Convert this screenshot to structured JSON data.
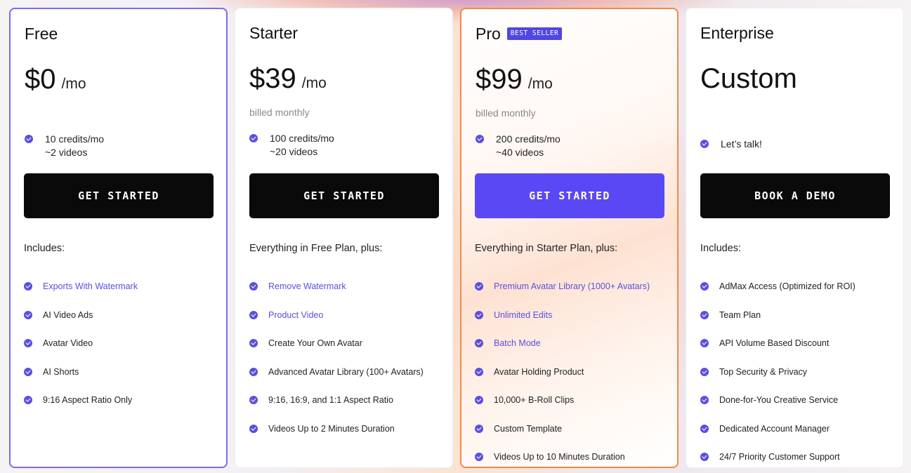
{
  "colors": {
    "accent": "#5a48f5",
    "highlight_text": "#5b4fe0",
    "pro_border": "#f08a4b",
    "free_border": "#7b6cf2"
  },
  "plans": [
    {
      "name": "Free",
      "price": "$0",
      "per": "/mo",
      "billed": "",
      "credits_line1": "10 credits/mo",
      "credits_line2": "~2 videos",
      "cta": "GET STARTED",
      "includes_head": "Includes:",
      "features": [
        {
          "label": "Exports With Watermark",
          "highlight": true
        },
        {
          "label": "AI Video Ads",
          "highlight": false
        },
        {
          "label": "Avatar Video",
          "highlight": false
        },
        {
          "label": "AI Shorts",
          "highlight": false
        },
        {
          "label": "9:16 Aspect Ratio Only",
          "highlight": false
        }
      ]
    },
    {
      "name": "Starter",
      "price": "$39",
      "per": "/mo",
      "billed": "billed monthly",
      "credits_line1": "100 credits/mo",
      "credits_line2": "~20 videos",
      "cta": "GET STARTED",
      "includes_head": "Everything in Free Plan, plus:",
      "features": [
        {
          "label": "Remove Watermark",
          "highlight": true
        },
        {
          "label": "Product Video",
          "highlight": true
        },
        {
          "label": "Create Your Own Avatar",
          "highlight": false
        },
        {
          "label": "Advanced Avatar Library (100+ Avatars)",
          "highlight": false
        },
        {
          "label": "9:16, 16:9, and 1:1 Aspect Ratio",
          "highlight": false
        },
        {
          "label": "Videos Up to 2 Minutes Duration",
          "highlight": false
        }
      ]
    },
    {
      "name": "Pro",
      "badge": "BEST SELLER",
      "price": "$99",
      "per": "/mo",
      "billed": "billed monthly",
      "credits_line1": "200 credits/mo",
      "credits_line2": "~40 videos",
      "cta": "GET STARTED",
      "includes_head": "Everything in Starter Plan, plus:",
      "features": [
        {
          "label": "Premium Avatar Library (1000+ Avatars)",
          "highlight": true
        },
        {
          "label": "Unlimited Edits",
          "highlight": true
        },
        {
          "label": "Batch Mode",
          "highlight": true
        },
        {
          "label": "Avatar Holding Product",
          "highlight": false
        },
        {
          "label": "10,000+ B-Roll Clips",
          "highlight": false
        },
        {
          "label": "Custom Template",
          "highlight": false
        },
        {
          "label": "Videos Up to 10 Minutes Duration",
          "highlight": false
        }
      ]
    },
    {
      "name": "Enterprise",
      "price": "Custom",
      "per": "",
      "billed": "",
      "credits_line1": "Let’s talk!",
      "credits_line2": "",
      "cta": "BOOK A DEMO",
      "includes_head": "Includes:",
      "features": [
        {
          "label": "AdMax Access (Optimized for ROI)",
          "highlight": false
        },
        {
          "label": "Team Plan",
          "highlight": false
        },
        {
          "label": "API Volume Based Discount",
          "highlight": false
        },
        {
          "label": "Top Security & Privacy",
          "highlight": false
        },
        {
          "label": "Done-for-You Creative Service",
          "highlight": false
        },
        {
          "label": "Dedicated Account Manager",
          "highlight": false
        },
        {
          "label": "24/7 Priority Customer Support",
          "highlight": false
        }
      ]
    }
  ]
}
